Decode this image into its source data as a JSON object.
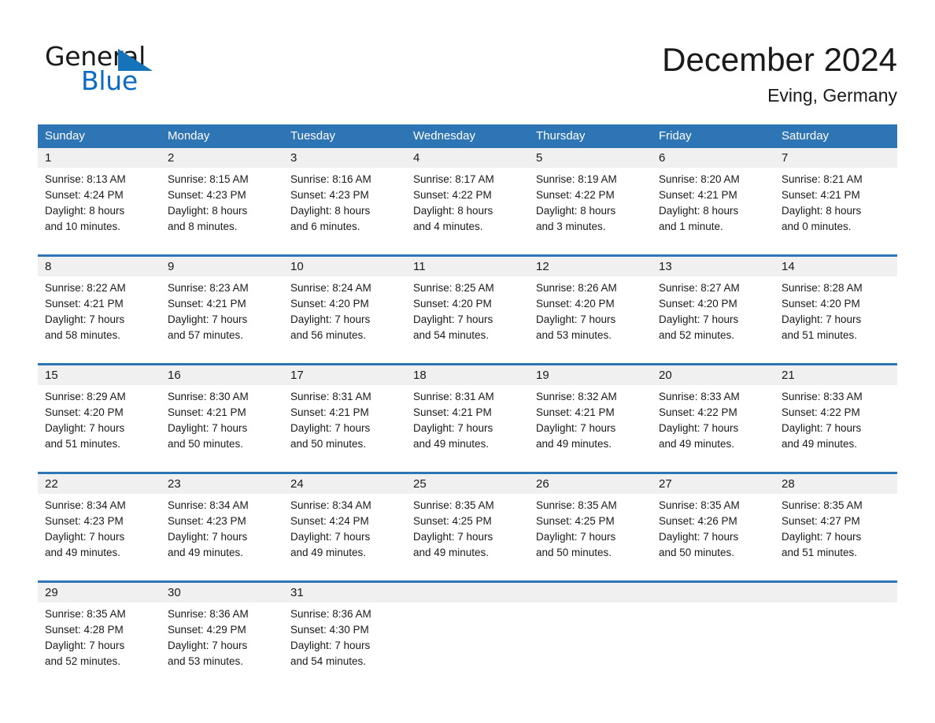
{
  "brand": {
    "name_part1": "General",
    "name_part2": "Blue"
  },
  "header": {
    "title": "December 2024",
    "subtitle": "Eving, Germany"
  },
  "colors": {
    "header_blue": "#2e75b6",
    "logo_blue": "#0a6bc4",
    "daynum_bg": "#f0f0f0",
    "text": "#1a1a1a"
  },
  "weekdays": [
    "Sunday",
    "Monday",
    "Tuesday",
    "Wednesday",
    "Thursday",
    "Friday",
    "Saturday"
  ],
  "weeks": [
    [
      {
        "day": "1",
        "sunrise": "Sunrise: 8:13 AM",
        "sunset": "Sunset: 4:24 PM",
        "daylight1": "Daylight: 8 hours",
        "daylight2": "and 10 minutes."
      },
      {
        "day": "2",
        "sunrise": "Sunrise: 8:15 AM",
        "sunset": "Sunset: 4:23 PM",
        "daylight1": "Daylight: 8 hours",
        "daylight2": "and 8 minutes."
      },
      {
        "day": "3",
        "sunrise": "Sunrise: 8:16 AM",
        "sunset": "Sunset: 4:23 PM",
        "daylight1": "Daylight: 8 hours",
        "daylight2": "and 6 minutes."
      },
      {
        "day": "4",
        "sunrise": "Sunrise: 8:17 AM",
        "sunset": "Sunset: 4:22 PM",
        "daylight1": "Daylight: 8 hours",
        "daylight2": "and 4 minutes."
      },
      {
        "day": "5",
        "sunrise": "Sunrise: 8:19 AM",
        "sunset": "Sunset: 4:22 PM",
        "daylight1": "Daylight: 8 hours",
        "daylight2": "and 3 minutes."
      },
      {
        "day": "6",
        "sunrise": "Sunrise: 8:20 AM",
        "sunset": "Sunset: 4:21 PM",
        "daylight1": "Daylight: 8 hours",
        "daylight2": "and 1 minute."
      },
      {
        "day": "7",
        "sunrise": "Sunrise: 8:21 AM",
        "sunset": "Sunset: 4:21 PM",
        "daylight1": "Daylight: 8 hours",
        "daylight2": "and 0 minutes."
      }
    ],
    [
      {
        "day": "8",
        "sunrise": "Sunrise: 8:22 AM",
        "sunset": "Sunset: 4:21 PM",
        "daylight1": "Daylight: 7 hours",
        "daylight2": "and 58 minutes."
      },
      {
        "day": "9",
        "sunrise": "Sunrise: 8:23 AM",
        "sunset": "Sunset: 4:21 PM",
        "daylight1": "Daylight: 7 hours",
        "daylight2": "and 57 minutes."
      },
      {
        "day": "10",
        "sunrise": "Sunrise: 8:24 AM",
        "sunset": "Sunset: 4:20 PM",
        "daylight1": "Daylight: 7 hours",
        "daylight2": "and 56 minutes."
      },
      {
        "day": "11",
        "sunrise": "Sunrise: 8:25 AM",
        "sunset": "Sunset: 4:20 PM",
        "daylight1": "Daylight: 7 hours",
        "daylight2": "and 54 minutes."
      },
      {
        "day": "12",
        "sunrise": "Sunrise: 8:26 AM",
        "sunset": "Sunset: 4:20 PM",
        "daylight1": "Daylight: 7 hours",
        "daylight2": "and 53 minutes."
      },
      {
        "day": "13",
        "sunrise": "Sunrise: 8:27 AM",
        "sunset": "Sunset: 4:20 PM",
        "daylight1": "Daylight: 7 hours",
        "daylight2": "and 52 minutes."
      },
      {
        "day": "14",
        "sunrise": "Sunrise: 8:28 AM",
        "sunset": "Sunset: 4:20 PM",
        "daylight1": "Daylight: 7 hours",
        "daylight2": "and 51 minutes."
      }
    ],
    [
      {
        "day": "15",
        "sunrise": "Sunrise: 8:29 AM",
        "sunset": "Sunset: 4:20 PM",
        "daylight1": "Daylight: 7 hours",
        "daylight2": "and 51 minutes."
      },
      {
        "day": "16",
        "sunrise": "Sunrise: 8:30 AM",
        "sunset": "Sunset: 4:21 PM",
        "daylight1": "Daylight: 7 hours",
        "daylight2": "and 50 minutes."
      },
      {
        "day": "17",
        "sunrise": "Sunrise: 8:31 AM",
        "sunset": "Sunset: 4:21 PM",
        "daylight1": "Daylight: 7 hours",
        "daylight2": "and 50 minutes."
      },
      {
        "day": "18",
        "sunrise": "Sunrise: 8:31 AM",
        "sunset": "Sunset: 4:21 PM",
        "daylight1": "Daylight: 7 hours",
        "daylight2": "and 49 minutes."
      },
      {
        "day": "19",
        "sunrise": "Sunrise: 8:32 AM",
        "sunset": "Sunset: 4:21 PM",
        "daylight1": "Daylight: 7 hours",
        "daylight2": "and 49 minutes."
      },
      {
        "day": "20",
        "sunrise": "Sunrise: 8:33 AM",
        "sunset": "Sunset: 4:22 PM",
        "daylight1": "Daylight: 7 hours",
        "daylight2": "and 49 minutes."
      },
      {
        "day": "21",
        "sunrise": "Sunrise: 8:33 AM",
        "sunset": "Sunset: 4:22 PM",
        "daylight1": "Daylight: 7 hours",
        "daylight2": "and 49 minutes."
      }
    ],
    [
      {
        "day": "22",
        "sunrise": "Sunrise: 8:34 AM",
        "sunset": "Sunset: 4:23 PM",
        "daylight1": "Daylight: 7 hours",
        "daylight2": "and 49 minutes."
      },
      {
        "day": "23",
        "sunrise": "Sunrise: 8:34 AM",
        "sunset": "Sunset: 4:23 PM",
        "daylight1": "Daylight: 7 hours",
        "daylight2": "and 49 minutes."
      },
      {
        "day": "24",
        "sunrise": "Sunrise: 8:34 AM",
        "sunset": "Sunset: 4:24 PM",
        "daylight1": "Daylight: 7 hours",
        "daylight2": "and 49 minutes."
      },
      {
        "day": "25",
        "sunrise": "Sunrise: 8:35 AM",
        "sunset": "Sunset: 4:25 PM",
        "daylight1": "Daylight: 7 hours",
        "daylight2": "and 49 minutes."
      },
      {
        "day": "26",
        "sunrise": "Sunrise: 8:35 AM",
        "sunset": "Sunset: 4:25 PM",
        "daylight1": "Daylight: 7 hours",
        "daylight2": "and 50 minutes."
      },
      {
        "day": "27",
        "sunrise": "Sunrise: 8:35 AM",
        "sunset": "Sunset: 4:26 PM",
        "daylight1": "Daylight: 7 hours",
        "daylight2": "and 50 minutes."
      },
      {
        "day": "28",
        "sunrise": "Sunrise: 8:35 AM",
        "sunset": "Sunset: 4:27 PM",
        "daylight1": "Daylight: 7 hours",
        "daylight2": "and 51 minutes."
      }
    ],
    [
      {
        "day": "29",
        "sunrise": "Sunrise: 8:35 AM",
        "sunset": "Sunset: 4:28 PM",
        "daylight1": "Daylight: 7 hours",
        "daylight2": "and 52 minutes."
      },
      {
        "day": "30",
        "sunrise": "Sunrise: 8:36 AM",
        "sunset": "Sunset: 4:29 PM",
        "daylight1": "Daylight: 7 hours",
        "daylight2": "and 53 minutes."
      },
      {
        "day": "31",
        "sunrise": "Sunrise: 8:36 AM",
        "sunset": "Sunset: 4:30 PM",
        "daylight1": "Daylight: 7 hours",
        "daylight2": "and 54 minutes."
      },
      {
        "day": "",
        "sunrise": "",
        "sunset": "",
        "daylight1": "",
        "daylight2": ""
      },
      {
        "day": "",
        "sunrise": "",
        "sunset": "",
        "daylight1": "",
        "daylight2": ""
      },
      {
        "day": "",
        "sunrise": "",
        "sunset": "",
        "daylight1": "",
        "daylight2": ""
      },
      {
        "day": "",
        "sunrise": "",
        "sunset": "",
        "daylight1": "",
        "daylight2": ""
      }
    ]
  ]
}
